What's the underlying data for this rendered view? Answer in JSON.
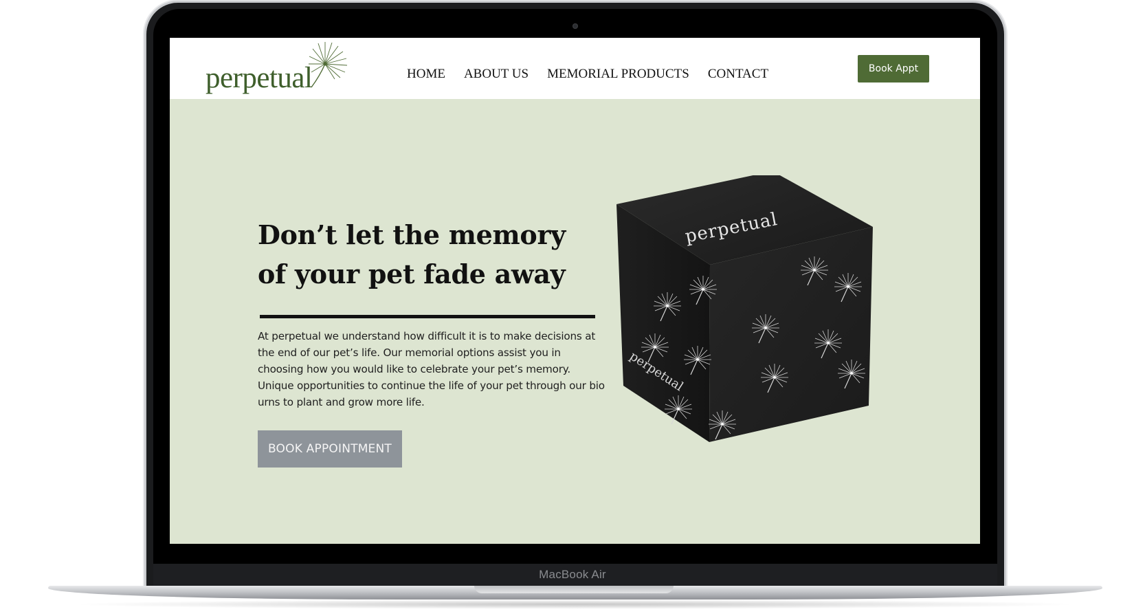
{
  "device": {
    "model_label": "MacBook Air"
  },
  "header": {
    "logo_text": "perpetual",
    "nav": [
      {
        "label": "HOME"
      },
      {
        "label": "ABOUT US"
      },
      {
        "label": "MEMORIAL PRODUCTS"
      },
      {
        "label": "CONTACT"
      }
    ],
    "cta_label": "Book Appt"
  },
  "hero": {
    "headline_line1": "Don’t let the memory",
    "headline_line2": "of your pet fade away",
    "body": "At perpetual we understand how difficult it is to make decisions at the end of our pet’s life. Our memorial options assist you in choosing how you would like to celebrate your pet’s memory. Unique opportunities to continue the life of your pet through our bio urns to plant and grow more life.",
    "button_label": "BOOK APPOINTMENT",
    "product_image": {
      "top_brand": "perpetual",
      "side_brand": "perpetual"
    }
  },
  "colors": {
    "brand_green": "#4f6b35",
    "hero_background": "#dde5d1",
    "secondary_button": "#8e949a",
    "box": "#1c1c1c"
  },
  "icons": [
    "dandelion-icon"
  ]
}
